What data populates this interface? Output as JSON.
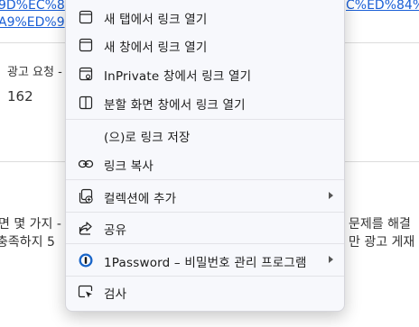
{
  "background": {
    "link_line1_left": "9D%EC%8",
    "link_line1_right": "C%ED%84%",
    "link_line2_left": "A9%ED%9",
    "row_label": "광고 요청 -",
    "row_value": "162",
    "para_line1_left": "면 몇 가지 -",
    "para_line1_right": "문제를 해결",
    "para_line2_left": "충족하지 5",
    "para_line2_right": "만 광고 게재"
  },
  "menu": {
    "items": [
      {
        "label": "새 탭에서 링크 열기",
        "icon": "new-tab-icon"
      },
      {
        "label": "새 창에서 링크 열기",
        "icon": "new-window-icon"
      },
      {
        "label": "InPrivate 창에서 링크 열기",
        "icon": "inprivate-window-icon"
      },
      {
        "label": "분할 화면 창에서 링크 열기",
        "icon": "split-screen-icon"
      },
      {
        "label": "(으)로 링크 저장",
        "icon": ""
      },
      {
        "label": "링크 복사",
        "icon": "link-icon"
      },
      {
        "label": "컬렉션에 추가",
        "icon": "collections-icon",
        "submenu": true
      },
      {
        "label": "공유",
        "icon": "share-icon"
      },
      {
        "label": "1Password – 비밀번호 관리 프로그램",
        "icon": "onepassword-icon",
        "submenu": true
      },
      {
        "label": "검사",
        "icon": "inspect-icon"
      }
    ]
  },
  "colors": {
    "link": "#1a5fd6",
    "menu_background": "#f7f8fc",
    "onepassword_blue": "#1a65c8"
  }
}
